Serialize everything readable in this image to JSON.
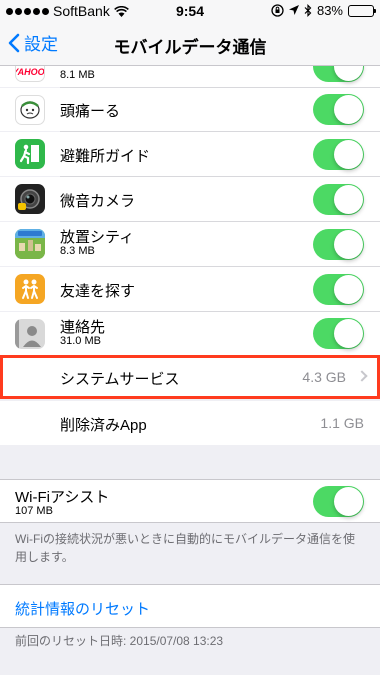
{
  "status_bar": {
    "carrier": "SoftBank",
    "time": "9:54",
    "battery": "83%",
    "battery_level": 0.83
  },
  "nav": {
    "back_label": "設定",
    "title": "モバイルデータ通信"
  },
  "apps": [
    {
      "name": "",
      "usage": "8.1 MB",
      "icon": "yahoo-app-icon",
      "enabled": true
    },
    {
      "name": "頭痛ーる",
      "usage": "",
      "icon": "zutool-app-icon",
      "enabled": true
    },
    {
      "name": "避難所ガイド",
      "usage": "",
      "icon": "evacuation-guide-icon",
      "enabled": true
    },
    {
      "name": "微音カメラ",
      "usage": "",
      "icon": "camera-app-icon",
      "enabled": true
    },
    {
      "name": "放置シティ",
      "usage": "8.3 MB",
      "icon": "city-game-icon",
      "enabled": true
    },
    {
      "name": "友達を探す",
      "usage": "",
      "icon": "find-friends-icon",
      "enabled": true
    },
    {
      "name": "連絡先",
      "usage": "31.0 MB",
      "icon": "contacts-icon",
      "enabled": true
    }
  ],
  "system_services": {
    "label": "システムサービス",
    "value": "4.3 GB"
  },
  "deleted_apps": {
    "label": "削除済みApp",
    "value": "1.1 GB"
  },
  "wifi_assist": {
    "label": "Wi-Fiアシスト",
    "usage": "107 MB",
    "enabled": true,
    "footer": "Wi-Fiの接続状況が悪いときに自動的にモバイルデータ通信を使用します。"
  },
  "reset": {
    "label": "統計情報のリセット",
    "last_reset": "前回のリセット日時: 2015/07/08 13:23"
  },
  "colors": {
    "toggle_on": "#4cd964",
    "link": "#007aff",
    "highlight": "#ff3b1e"
  }
}
